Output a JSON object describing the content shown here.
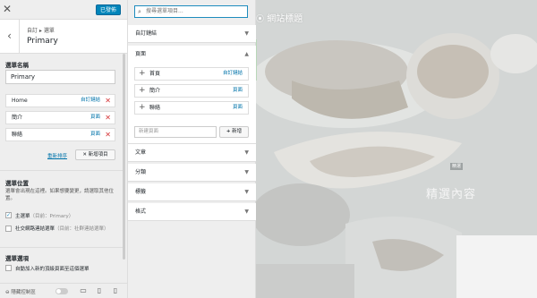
{
  "header": {
    "published_label": "已發佈",
    "breadcrumb": "自訂 ▸ 選單",
    "menu_title": "Primary"
  },
  "menu_name": {
    "label": "選單名稱",
    "value": "Primary"
  },
  "menu_items": [
    {
      "title": "Home",
      "type": "自訂鏈結"
    },
    {
      "title": "簡介",
      "type": "頁面"
    },
    {
      "title": "聯絡",
      "type": "頁面"
    }
  ],
  "actions": {
    "reorder": "重新排序",
    "add_item": "新增項目"
  },
  "locations": {
    "label": "選單位置",
    "description": "選單會出現在這裡。如果想要變更，請選取其他位置。",
    "options": [
      {
        "label": "主選單",
        "sub": "（目前：Primary）",
        "checked": true
      },
      {
        "label": "社交網路連結選單",
        "sub": "（目前：社群連結選單）",
        "checked": false
      }
    ]
  },
  "options": {
    "label": "選單選項",
    "auto_add": "自動加入新的頂級頁面至這個選單"
  },
  "footer": {
    "hide_controls": "隱藏控制區"
  },
  "picker": {
    "search_placeholder": "搜尋選單項目...",
    "sections": {
      "custom_links": "自訂鏈結",
      "pages": "頁面",
      "posts": "文章",
      "categories": "分類",
      "tags": "標籤",
      "formats": "格式"
    },
    "page_items": [
      {
        "title": "首頁",
        "type": "自訂鏈結"
      },
      {
        "title": "簡介",
        "type": "頁面"
      },
      {
        "title": "聯絡",
        "type": "頁面"
      }
    ],
    "new_page_placeholder": "新建頁面",
    "add_new": "新增"
  },
  "preview": {
    "site_title": "網站標題",
    "featured_badge": "精選",
    "featured_title": "精選內容"
  },
  "colors": {
    "accent": "#0085ba",
    "link": "#0073aa",
    "remove": "#d63638"
  }
}
